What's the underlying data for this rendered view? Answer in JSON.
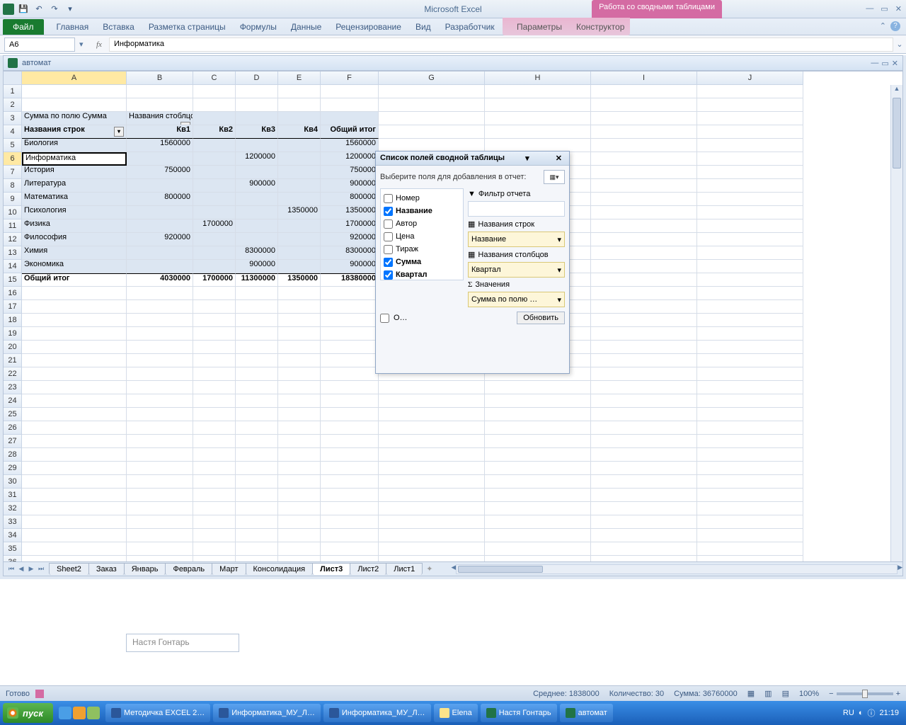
{
  "app_title": "Microsoft Excel",
  "contextual_tab_title": "Работа со сводными таблицами",
  "file_tab": "Файл",
  "ribbon_tabs": [
    "Главная",
    "Вставка",
    "Разметка страницы",
    "Формулы",
    "Данные",
    "Рецензирование",
    "Вид",
    "Разработчик"
  ],
  "ctx_tabs": [
    "Параметры",
    "Конструктор"
  ],
  "namebox": "A6",
  "formula": "Информатика",
  "doc_title": "автомат",
  "columns": [
    "A",
    "B",
    "C",
    "D",
    "E",
    "F",
    "G",
    "H",
    "I",
    "J"
  ],
  "pivot": {
    "header_a3": "Сумма по полю Сумма",
    "header_b3": "Названия стоблцов",
    "header_a4": "Названия строк",
    "cols": [
      "Кв1",
      "Кв2",
      "Кв3",
      "Кв4",
      "Общий итог"
    ],
    "rows": [
      {
        "label": "Биология",
        "vals": [
          "1560000",
          "",
          "",
          "",
          "1560000"
        ]
      },
      {
        "label": "Информатика",
        "vals": [
          "",
          "",
          "1200000",
          "",
          "1200000"
        ]
      },
      {
        "label": "История",
        "vals": [
          "750000",
          "",
          "",
          "",
          "750000"
        ]
      },
      {
        "label": "Литература",
        "vals": [
          "",
          "",
          "900000",
          "",
          "900000"
        ]
      },
      {
        "label": "Математика",
        "vals": [
          "800000",
          "",
          "",
          "",
          "800000"
        ]
      },
      {
        "label": "Психология",
        "vals": [
          "",
          "",
          "",
          "1350000",
          "1350000"
        ]
      },
      {
        "label": "Физика",
        "vals": [
          "",
          "1700000",
          "",
          "",
          "1700000"
        ]
      },
      {
        "label": "Философия",
        "vals": [
          "920000",
          "",
          "",
          "",
          "920000"
        ]
      },
      {
        "label": "Химия",
        "vals": [
          "",
          "",
          "8300000",
          "",
          "8300000"
        ]
      },
      {
        "label": "Экономика",
        "vals": [
          "",
          "",
          "900000",
          "",
          "900000"
        ]
      }
    ],
    "total_label": "Общий итог",
    "totals": [
      "4030000",
      "1700000",
      "11300000",
      "1350000",
      "18380000"
    ]
  },
  "pivot_pane": {
    "title": "Список полей сводной таблицы",
    "sub": "Выберите поля для добавления в отчет:",
    "fields": [
      {
        "name": "Номер",
        "checked": false
      },
      {
        "name": "Название",
        "checked": true
      },
      {
        "name": "Автор",
        "checked": false
      },
      {
        "name": "Цена",
        "checked": false
      },
      {
        "name": "Тираж",
        "checked": false
      },
      {
        "name": "Сумма",
        "checked": true
      },
      {
        "name": "Квартал",
        "checked": true
      }
    ],
    "filter_label": "Фильтр отчета",
    "rows_label": "Названия строк",
    "rows_val": "Название",
    "cols_label": "Названия столбцов",
    "cols_val": "Квартал",
    "vals_label": "Значения",
    "vals_val": "Сумма по полю …",
    "defer": "О…",
    "update": "Обновить"
  },
  "sheets": [
    "Sheet2",
    "Заказ",
    "Январь",
    "Февраль",
    "Март",
    "Консолидация",
    "Лист3",
    "Лист2",
    "Лист1"
  ],
  "active_sheet": "Лист3",
  "textbox_placeholder": "Настя Гонтарь",
  "status": {
    "ready": "Готово",
    "avg": "Среднее: 1838000",
    "count": "Количество: 30",
    "sum": "Сумма: 36760000",
    "zoom": "100%"
  },
  "taskbar": {
    "start": "пуск",
    "items": [
      {
        "label": "Методичка EXCEL 2…",
        "type": "word"
      },
      {
        "label": "Информатика_МУ_Л…",
        "type": "word"
      },
      {
        "label": "Информатика_МУ_Л…",
        "type": "word"
      },
      {
        "label": "Elena",
        "type": "folder"
      },
      {
        "label": "Настя Гонтарь",
        "type": "excel"
      },
      {
        "label": "автомат",
        "type": "excel"
      }
    ],
    "lang": "RU",
    "time": "21:19"
  }
}
